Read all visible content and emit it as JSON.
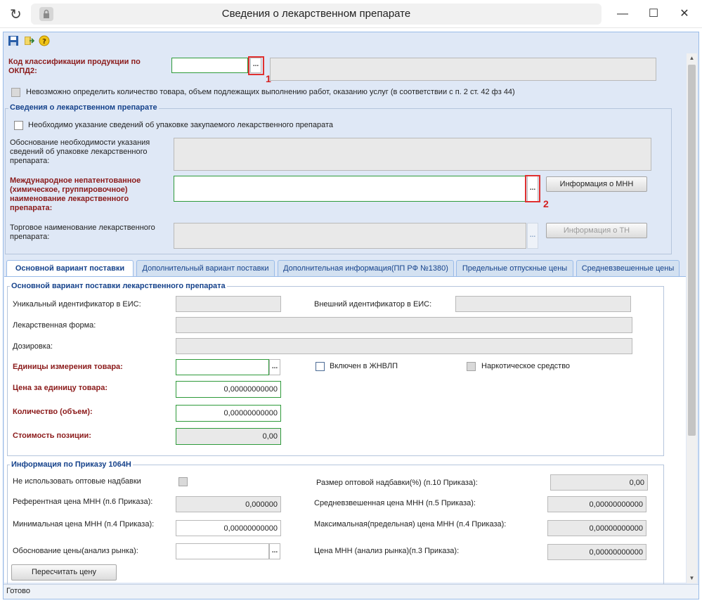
{
  "window": {
    "title": "Сведения о лекарственном препарате",
    "refresh_icon": "↻",
    "minimize": "—",
    "maximize": "☐",
    "close": "✕"
  },
  "top": {
    "okpd_label": "Код классификации продукции по ОКПД2:",
    "okpd_value": "",
    "okpd_name": "",
    "okpd_trigger": "...",
    "marker_1": "1",
    "cannot_determine_label": "Невозможно определить количество товара, объем подлежащих выполнению работ, оказанию услуг (в соответствии с п. 2 ст. 42 фз 44)"
  },
  "drug": {
    "section_title": "Сведения о лекарственном препарате",
    "packaging_required_label": "Необходимо указание сведений об упаковке закупаемого лекарственного препарата",
    "packaging_reason_label": "Обоснование необходимости указания сведений об упаковке лекарственного препарата:",
    "packaging_reason_value": "",
    "inn_label": "Международное непатентованное (химическое, группировочное) наименование лекарственного препарата:",
    "inn_value": "",
    "inn_trigger": "...",
    "marker_2": "2",
    "inn_info_button": "Информация о МНН",
    "trade_name_label": "Торговое наименование лекарственного препарата:",
    "trade_name_value": "",
    "trade_name_trigger": "...",
    "tn_info_button": "Информация о ТН"
  },
  "tabs": [
    {
      "label": "Основной вариант поставки"
    },
    {
      "label": "Дополнительный вариант поставки"
    },
    {
      "label": "Дополнительная информация(ПП РФ №1380)"
    },
    {
      "label": "Предельные отпускные цены"
    },
    {
      "label": "Средневзвешенные цены"
    }
  ],
  "main": {
    "section_title": "Основной вариант поставки лекарственного препарата",
    "eis_id_label": "Уникальный идентификатор в ЕИС:",
    "eis_id_value": "",
    "ext_id_label": "Внешний идентификатор в ЕИС:",
    "ext_id_value": "",
    "form_label": "Лекарственная форма:",
    "form_value": "",
    "dosage_label": "Дозировка:",
    "dosage_value": "",
    "units_label": "Единицы измерения товара:",
    "units_value": "",
    "units_trigger": "...",
    "zhnvlp_label": "Включен в ЖНВЛП",
    "narcotic_label": "Наркотическое средство",
    "price_label": "Цена за единицу товара:",
    "price_value": "0,00000000000",
    "qty_label": "Количество (объем):",
    "qty_value": "0,00000000000",
    "cost_label": "Стоимость позиции:",
    "cost_value": "0,00"
  },
  "order": {
    "section_title": "Информация по Приказу 1064Н",
    "no_wholesale_label": "Не использовать оптовые надбавки",
    "markup_label": "Размер оптовой надбавки(%) (п.10 Приказа):",
    "markup_value": "0,00",
    "ref_price_label": "Референтная цена МНН (п.6 Приказа):",
    "ref_price_value": "0,000000",
    "wavg_price_label": "Средневзвешенная цена МНН (п.5 Приказа):",
    "wavg_price_value": "0,00000000000",
    "min_price_label": "Минимальная цена МНН (п.4 Приказа):",
    "min_price_value": "0,00000000000",
    "max_price_label": "Максимальная(предельная) цена МНН (п.4 Приказа):",
    "max_price_value": "0,00000000000",
    "price_reason_label": "Обоснование цены(анализ рынка):",
    "price_reason_value": "",
    "price_reason_trigger": "...",
    "market_price_label": "Цена МНН (анализ рынка)(п.3 Приказа):",
    "market_price_value": "0,00000000000",
    "recalc_button": "Пересчитать цену"
  },
  "status": {
    "text": "Готово"
  }
}
